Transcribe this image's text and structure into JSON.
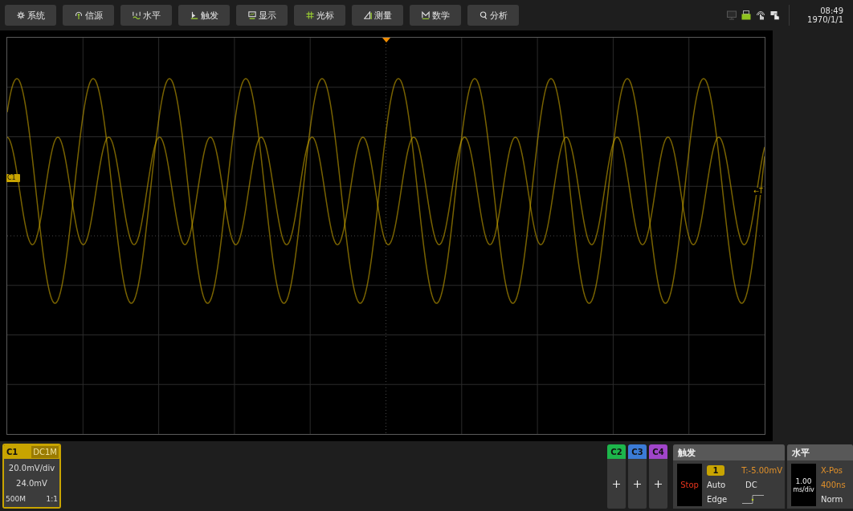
{
  "toolbar": {
    "buttons": [
      "系统",
      "信源",
      "水平",
      "触发",
      "显示",
      "光标",
      "测量",
      "数学",
      "分析"
    ]
  },
  "clock": {
    "time": "08:49",
    "date": "1970/1/1"
  },
  "display": {
    "channel_marker": "C1",
    "trigger_level_marker": "←T"
  },
  "channels": [
    {
      "label": "C1",
      "enabled": true,
      "color": "#c8a400",
      "coupling": "DC1M",
      "scale": "20.0mV/div",
      "offset": "24.0mV",
      "bandwidth": "500M",
      "probe": "1:1"
    },
    {
      "label": "C2",
      "enabled": false,
      "color": "#1db64b"
    },
    {
      "label": "C3",
      "enabled": false,
      "color": "#3b7bd6"
    },
    {
      "label": "C4",
      "enabled": false,
      "color": "#a045c9"
    }
  ],
  "trigger": {
    "title": "触发",
    "run_state": "Stop",
    "source": "1",
    "level": "T:-5.00mV",
    "mode": "Auto",
    "coupling": "DC",
    "type": "Edge"
  },
  "horizontal": {
    "title": "水平",
    "scale": "1.00",
    "scale_unit": "ms/div",
    "position_label": "X-Pos",
    "position": "400ns",
    "mode": "Norm"
  }
}
